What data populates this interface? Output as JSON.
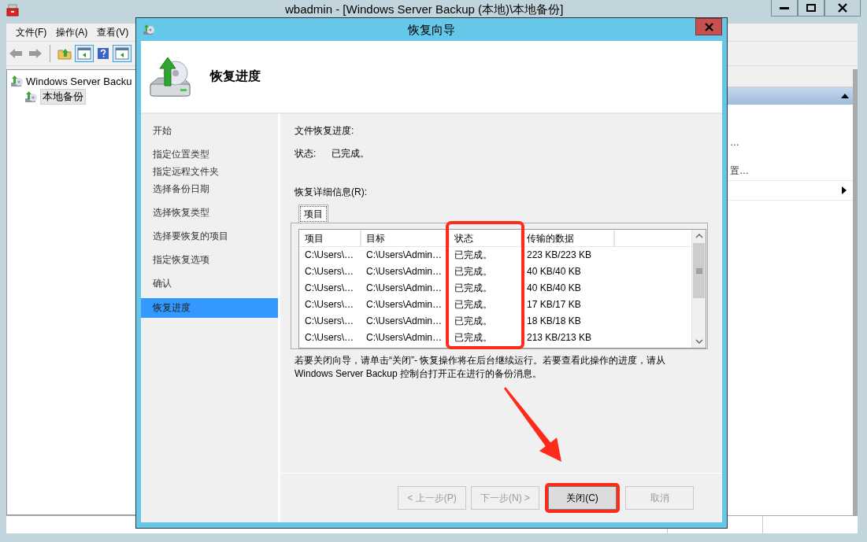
{
  "main_window": {
    "title": "wbadmin - [Windows Server Backup (本地)\\本地备份]",
    "menu": [
      {
        "label": "文件(F)"
      },
      {
        "label": "操作(A)"
      },
      {
        "label": "查看(V)"
      }
    ],
    "toolbar": [
      {
        "kind": "back",
        "pressed": false
      },
      {
        "kind": "forward",
        "pressed": false
      },
      {
        "kind": "separator",
        "pressed": false
      },
      {
        "kind": "up",
        "pressed": false
      },
      {
        "kind": "pane",
        "pressed": true
      },
      {
        "kind": "help",
        "pressed": false
      },
      {
        "kind": "pane",
        "pressed": true
      }
    ],
    "tree": [
      {
        "label": "Windows Server Backu",
        "selected": false,
        "children": [
          {
            "label": "本地备份",
            "selected": true
          }
        ]
      }
    ],
    "actions_pane": {
      "items": [
        {
          "kind": "text",
          "label": "…"
        },
        {
          "kind": "text",
          "label": "置…"
        },
        {
          "kind": "submenu"
        }
      ]
    }
  },
  "dialog": {
    "title": "恢复向导",
    "heading": "恢复进度",
    "step_groups": [
      [
        {
          "label": "开始",
          "selected": false
        }
      ],
      [
        {
          "label": "指定位置类型",
          "selected": false
        },
        {
          "label": "指定远程文件夹",
          "selected": false
        },
        {
          "label": "选择备份日期",
          "selected": false
        }
      ],
      [
        {
          "label": "选择恢复类型",
          "selected": false
        }
      ],
      [
        {
          "label": "选择要恢复的项目",
          "selected": false
        }
      ],
      [
        {
          "label": "指定恢复选项",
          "selected": false
        }
      ],
      [
        {
          "label": "确认",
          "selected": false
        }
      ],
      [
        {
          "label": "恢复进度",
          "selected": true
        }
      ]
    ],
    "progress_label": "文件恢复进度:",
    "status_label": "状态:",
    "status_value": "已完成。",
    "details_label": "恢复详细信息(R):",
    "tabs": [
      {
        "label": "项目",
        "selected": true
      }
    ],
    "table": {
      "columns": [
        "项目",
        "目标",
        "状态",
        "传输的数据"
      ],
      "rows": [
        [
          "C:\\Users\\…",
          "C:\\Users\\Admin…",
          "已完成。",
          "223 KB/223 KB"
        ],
        [
          "C:\\Users\\…",
          "C:\\Users\\Admin…",
          "已完成。",
          "40 KB/40 KB"
        ],
        [
          "C:\\Users\\…",
          "C:\\Users\\Admin…",
          "已完成。",
          "40 KB/40 KB"
        ],
        [
          "C:\\Users\\…",
          "C:\\Users\\Admin…",
          "已完成。",
          "17 KB/17 KB"
        ],
        [
          "C:\\Users\\…",
          "C:\\Users\\Admin…",
          "已完成。",
          "18 KB/18 KB"
        ],
        [
          "C:\\Users\\…",
          "C:\\Users\\Admin…",
          "已完成。",
          "213 KB/213 KB"
        ]
      ]
    },
    "note": "若要关闭向导，请单击“关闭”- 恢复操作将在后台继续运行。若要查看此操作的进度，请从 Windows Server Backup 控制台打开正在进行的备份消息。",
    "buttons": [
      {
        "label": "< 上一步(P)",
        "disabled": true,
        "default": false
      },
      {
        "label": "下一步(N) >",
        "disabled": true,
        "default": false
      },
      {
        "label": "关闭(C)",
        "disabled": false,
        "default": true
      },
      {
        "label": "取消",
        "disabled": true,
        "default": false
      }
    ]
  },
  "annotations": [
    {
      "kind": "column-highlight"
    },
    {
      "kind": "button-highlight"
    },
    {
      "kind": "arrow"
    }
  ]
}
